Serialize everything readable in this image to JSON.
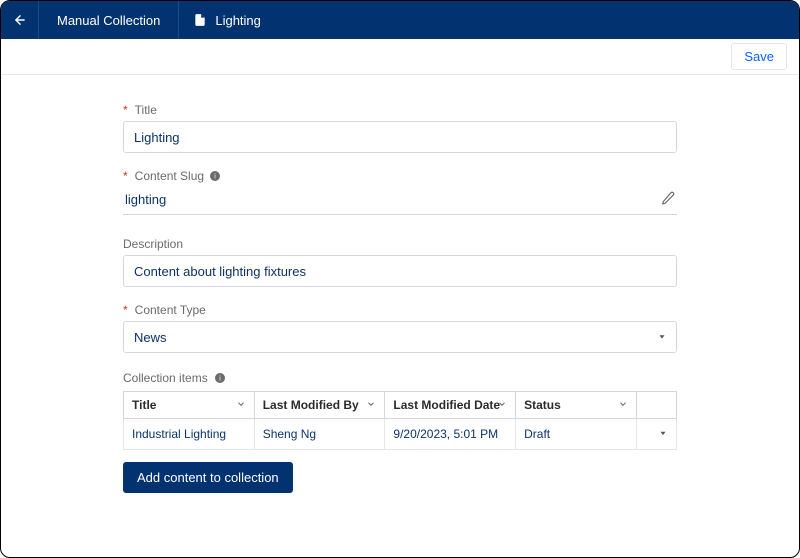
{
  "header": {
    "breadcrumb": "Manual Collection",
    "doc_title": "Lighting"
  },
  "toolbar": {
    "save_label": "Save"
  },
  "fields": {
    "title_label": "Title",
    "title_value": "Lighting",
    "slug_label": "Content Slug",
    "slug_value": "lighting",
    "description_label": "Description",
    "description_value": "Content about lighting fixtures",
    "content_type_label": "Content Type",
    "content_type_value": "News"
  },
  "collection": {
    "section_label": "Collection items",
    "columns": {
      "title": "Title",
      "modified_by": "Last Modified By",
      "modified_date": "Last Modified Date",
      "status": "Status"
    },
    "rows": [
      {
        "title": "Industrial Lighting",
        "modified_by": "Sheng Ng",
        "modified_date": "9/20/2023, 5:01 PM",
        "status": "Draft"
      }
    ],
    "add_button": "Add content to collection"
  }
}
